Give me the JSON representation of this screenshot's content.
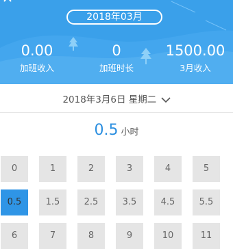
{
  "header": {
    "month": "2018年03月",
    "stats": [
      {
        "value": "0.00",
        "label": "加班收入"
      },
      {
        "value": "0",
        "label": "加班时长"
      },
      {
        "value": "1500.00",
        "label": "3月收入"
      }
    ],
    "color": "#3aa0ea"
  },
  "date_selector": {
    "label": "2018年3月6日 星期二"
  },
  "selected_hours": {
    "value": "0.5",
    "unit": "小时"
  },
  "grid": {
    "rows": [
      [
        "0",
        "1",
        "2",
        "3",
        "4",
        "5"
      ],
      [
        "0.5",
        "1.5",
        "2.5",
        "3.5",
        "4.5",
        "5.5"
      ],
      [
        "6",
        "7",
        "8",
        "9",
        "10",
        "11"
      ]
    ],
    "selected": "0.5",
    "accent": "#2f95e6"
  },
  "icons": [
    "back-arrow-icon",
    "chevron-down-icon",
    "tree-icon"
  ]
}
